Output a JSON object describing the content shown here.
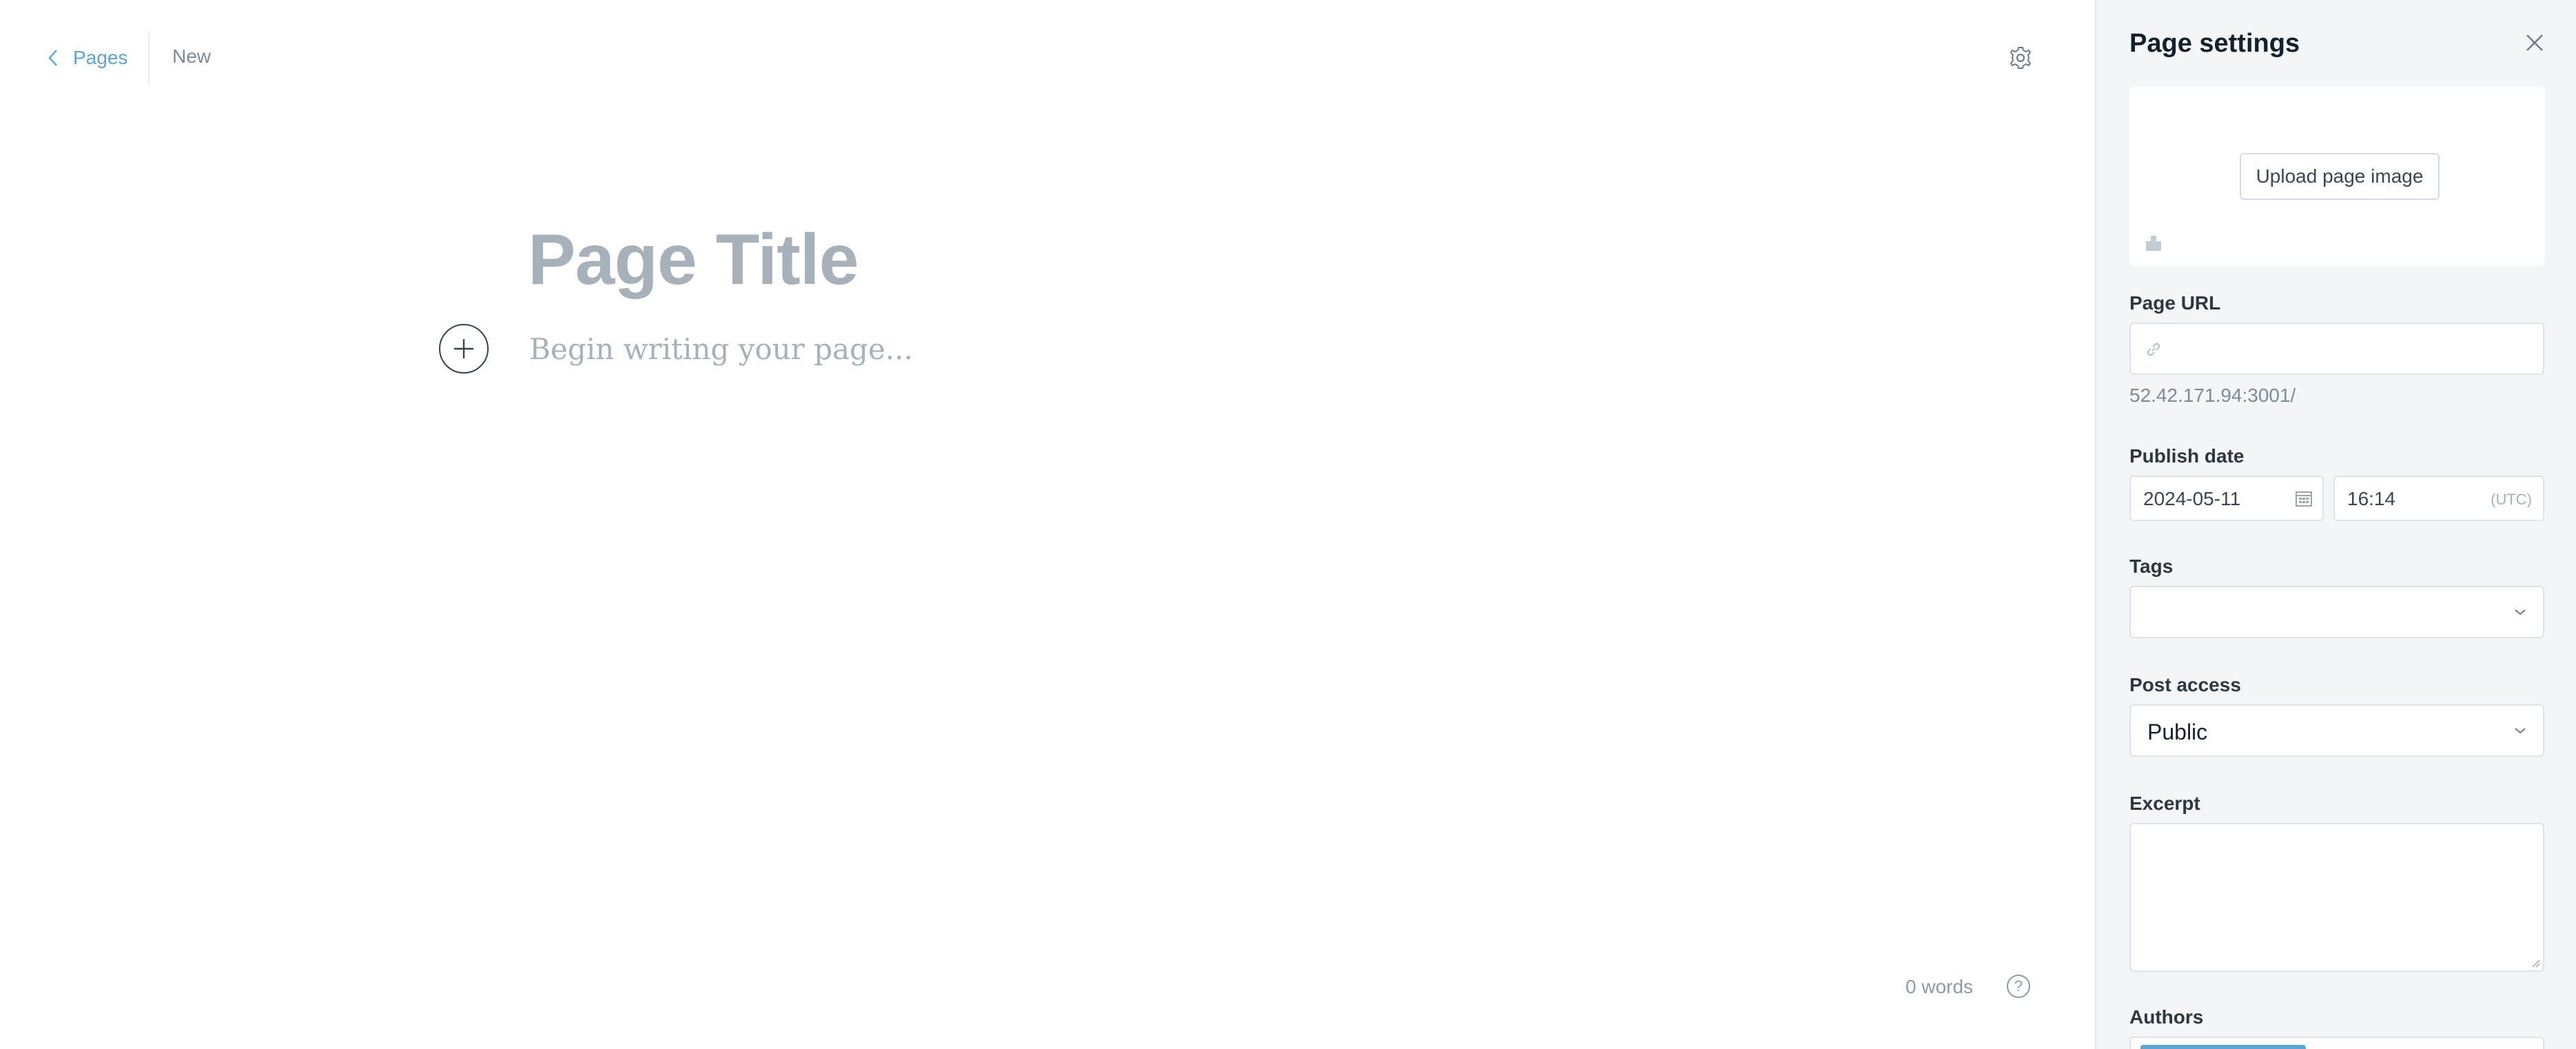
{
  "editor": {
    "back_label": "Pages",
    "status": "New",
    "title_placeholder": "Page Title",
    "body_placeholder": "Begin writing your page...",
    "word_count": "0 words",
    "help_label": "?"
  },
  "settings": {
    "title": "Page settings",
    "upload_label": "Upload page image",
    "url_label": "Page URL",
    "url_value": "",
    "url_hint": "52.42.171.94:3001/",
    "publish_label": "Publish date",
    "date_value": "2024-05-11",
    "time_value": "16:14",
    "timezone": "(UTC)",
    "tags_label": "Tags",
    "tags_value": "",
    "access_label": "Post access",
    "access_value": "Public",
    "excerpt_label": "Excerpt",
    "excerpt_value": "",
    "authors_label": "Authors"
  },
  "colors": {
    "accent": "#5aa4d8",
    "placeholder": "#a6b1ba",
    "panel_bg": "#f4f5f6"
  },
  "icons": [
    "chevron-left-icon",
    "gear-icon",
    "plus-icon",
    "help-icon",
    "close-icon",
    "image-icon",
    "link-icon",
    "calendar-icon",
    "chevron-down-icon"
  ]
}
